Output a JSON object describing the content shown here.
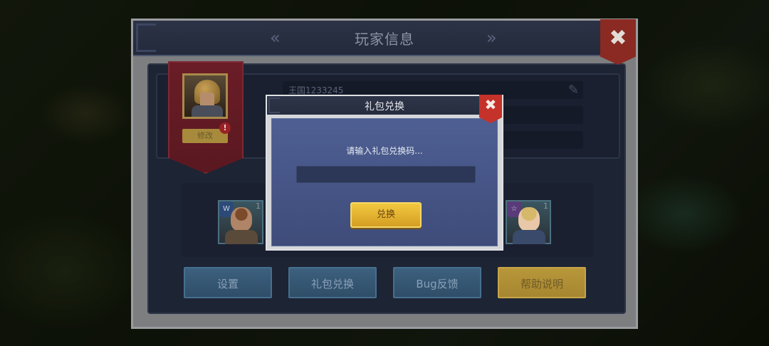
{
  "main_panel": {
    "title": "玩家信息",
    "kingdom_name": "王国1233245",
    "rename_label": "修改",
    "notice_badge": "!"
  },
  "heroes": [
    {
      "level": "1"
    },
    {
      "level": "1"
    }
  ],
  "menu": {
    "settings": "设置",
    "gift_redeem": "礼包兑换",
    "bug_feedback": "Bug反馈",
    "help": "帮助说明"
  },
  "gift_modal": {
    "title": "礼包兑换",
    "prompt": "请输入礼包兑换码...",
    "code_value": "",
    "redeem_label": "兑换"
  },
  "icons": {
    "close": "✖",
    "edit": "✎",
    "arrow_left": "«",
    "arrow_right": "»"
  },
  "colors": {
    "panel_header": "#2c3346",
    "accent_gold": "#f2c840",
    "close_red": "#c4322a",
    "button_blue": "#3c607e"
  }
}
